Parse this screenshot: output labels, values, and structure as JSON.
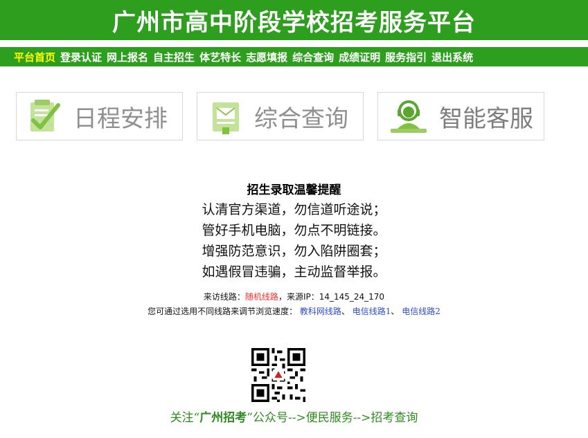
{
  "header": {
    "title": "广州市高中阶段学校招考服务平台"
  },
  "nav": {
    "items": [
      {
        "label": "平台首页",
        "active": true
      },
      {
        "label": "登录认证"
      },
      {
        "label": "网上报名"
      },
      {
        "label": "自主招生"
      },
      {
        "label": "体艺特长"
      },
      {
        "label": "志愿填报"
      },
      {
        "label": "综合查询"
      },
      {
        "label": "成绩证明"
      },
      {
        "label": "服务指引"
      },
      {
        "label": "退出系统"
      }
    ]
  },
  "tiles": {
    "schedule": {
      "label": "日程安排",
      "icon": "checklist-icon"
    },
    "query": {
      "label": "综合查询",
      "icon": "mail-document-icon"
    },
    "service": {
      "label": "智能客服",
      "icon": "customer-service-icon"
    }
  },
  "notice": {
    "title": "招生录取温馨提醒",
    "lines": [
      "认清官方渠道，勿信道听途说；",
      "管好手机电脑，勿点不明链接。",
      "增强防范意识，勿入陷阱圈套；",
      "如遇假冒违骗，主动监督举报。"
    ]
  },
  "route": {
    "prefix": "来访线路：",
    "line": "随机线路",
    "source_label": "，来源IP：",
    "ip": "14_145_24_170",
    "hint": "您可通过选用不同线路来调节浏览速度：",
    "links": [
      "教科网线路",
      "电信线路1",
      "电信线路2"
    ],
    "sep": "、"
  },
  "follow": {
    "prefix": "关注“",
    "account": "广州招考",
    "suffix": "”公众号-->便民服务-->招考查询"
  },
  "colors": {
    "brand": "#2e9e1f",
    "active_nav": "#ffff00",
    "link": "#2a4bd0",
    "alert": "#ff2a2a"
  }
}
